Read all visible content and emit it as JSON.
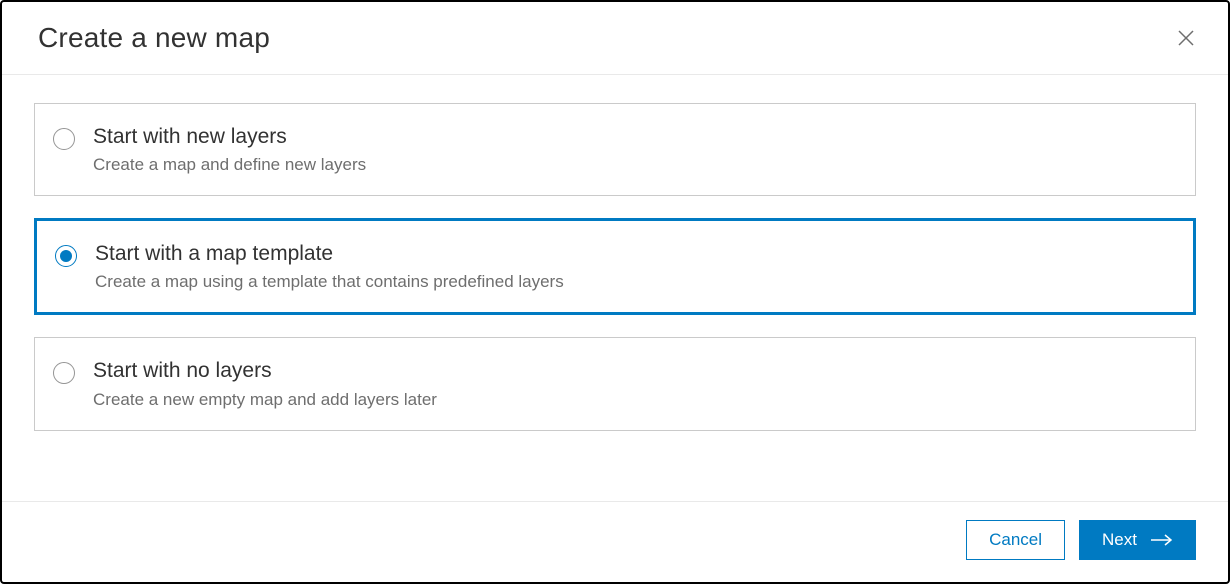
{
  "dialog": {
    "title": "Create a new map"
  },
  "options": [
    {
      "title": "Start with new layers",
      "description": "Create a map and define new layers",
      "selected": false
    },
    {
      "title": "Start with a map template",
      "description": "Create a map using a template that contains predefined layers",
      "selected": true
    },
    {
      "title": "Start with no layers",
      "description": "Create a new empty map and add layers later",
      "selected": false
    }
  ],
  "buttons": {
    "cancel": "Cancel",
    "next": "Next"
  }
}
